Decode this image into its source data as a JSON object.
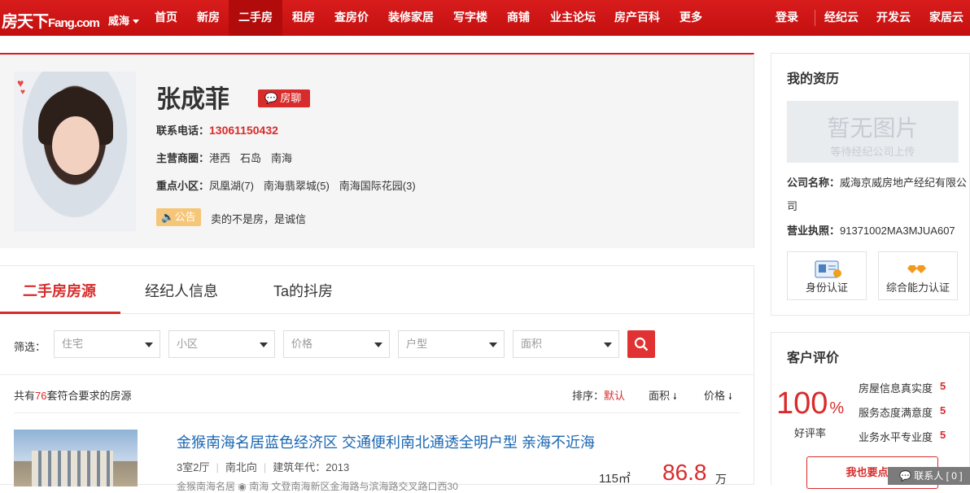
{
  "topnav": {
    "logo": "房天下",
    "logo_en": "Fang.com",
    "city": "威海",
    "items": [
      {
        "label": "首页"
      },
      {
        "label": "新房"
      },
      {
        "label": "二手房"
      },
      {
        "label": "租房"
      },
      {
        "label": "查房价"
      },
      {
        "label": "装修家居"
      },
      {
        "label": "写字楼"
      },
      {
        "label": "商铺"
      },
      {
        "label": "业主论坛"
      },
      {
        "label": "房产百科"
      },
      {
        "label": "更多"
      }
    ],
    "active": "二手房",
    "right": [
      {
        "label": "登录"
      },
      {
        "label": "经纪云"
      },
      {
        "label": "开发云"
      },
      {
        "label": "家居云"
      }
    ]
  },
  "agent": {
    "name": "张成菲",
    "chat_label": "房聊",
    "phone_label": "联系电话：",
    "phone": "13061150432",
    "district_label": "主营商圈：",
    "districts": [
      "港西",
      "石岛",
      "南海"
    ],
    "communities_label": "重点小区：",
    "communities": [
      "凤凰湖(7)",
      "南海翡翠城(5)",
      "南海国际花园(3)"
    ],
    "notice_label": "公告",
    "notice": "卖的不是房，是诚信"
  },
  "tabs": [
    {
      "label": "二手房房源"
    },
    {
      "label": "经纪人信息"
    },
    {
      "label": "Ta的抖房"
    }
  ],
  "filter": {
    "label": "筛选：",
    "selects": [
      {
        "placeholder": "住宅"
      },
      {
        "placeholder": "小区"
      },
      {
        "placeholder": "价格"
      },
      {
        "placeholder": "户型"
      },
      {
        "placeholder": "面积"
      }
    ]
  },
  "results": {
    "prefix": "共有",
    "count": "76",
    "suffix": "套符合要求的房源",
    "sort_label": "排序：",
    "sort_default": "默认",
    "sort_area": "面积",
    "sort_price": "价格"
  },
  "listing": {
    "title": "金猴南海名居蓝色经济区 交通便利南北通透全明户型 亲海不近海",
    "layout": "3室2厅",
    "orientation": "南北向",
    "year": "建筑年代：2013",
    "community": "金猴南海名居",
    "address": "南海  文登南海新区金海路与滨海路交叉路口西30",
    "area": "115㎡",
    "price": "86.8",
    "price_unit": "万"
  },
  "sidebar": {
    "title": "我的资历",
    "no_image": "暂无图片",
    "no_image_sub": "等待经纪公司上传",
    "company_label": "公司名称：",
    "company": "威海京威房地产经纪有限公司",
    "license_label": "营业执照：",
    "license": "91371002MA3MJUA607",
    "cert1": "身份认证",
    "cert2": "综合能力认证"
  },
  "reviews": {
    "title": "客户评价",
    "percent": "100",
    "percent_sign": "%",
    "good_label": "好评率",
    "items": [
      {
        "label": "房屋信息真实度",
        "score": "5"
      },
      {
        "label": "服务态度满意度",
        "score": "5"
      },
      {
        "label": "业务水平专业度",
        "score": "5"
      }
    ],
    "button": "我也要点评"
  },
  "chatbar": {
    "label": "联系人 [ 0 ]"
  },
  "colors": {
    "brand": "#d71a1a",
    "accent": "#d82b2b",
    "link": "#1a66b3"
  }
}
